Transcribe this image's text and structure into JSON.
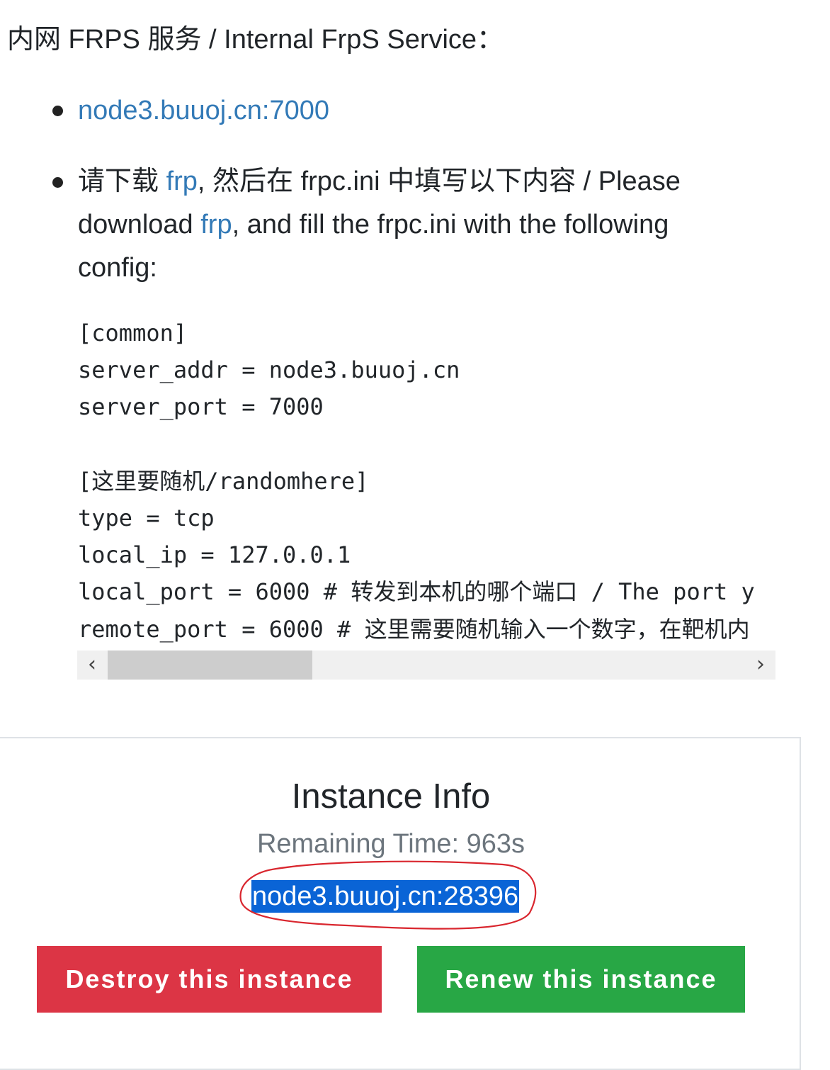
{
  "heading": "内网 FRPS 服务 / Internal FrpS Service：",
  "bullets": {
    "server_link": "node3.buuoj.cn:7000",
    "instruction_pre": "请下载 ",
    "frp_link_1": "frp",
    "instruction_mid": ", 然后在 frpc.ini 中填写以下内容 / Please download ",
    "frp_link_2": "frp",
    "instruction_post": ", and fill the frpc.ini with the following config:"
  },
  "config_code": "[common]\nserver_addr = node3.buuoj.cn\nserver_port = 7000\n\n[这里要随机/randomhere]\ntype = tcp\nlocal_ip = 127.0.0.1\nlocal_port = 6000 # 转发到本机的哪个端口 / The port y\nremote_port = 6000 # 这里需要随机输入一个数字，在靶机内",
  "scrollbar": {
    "left_arrow": "‹",
    "right_arrow": "›",
    "thumb_position": 0.0
  },
  "instance": {
    "title": "Instance Info",
    "remaining": "Remaining Time: 963s",
    "address": "node3.buuoj.cn:28396",
    "destroy_label": "Destroy this instance",
    "renew_label": "Renew this instance"
  },
  "colors": {
    "link": "#337ab7",
    "destroy": "#dc3545",
    "renew": "#28a745",
    "selection": "#0a64d6",
    "annotation": "#d9262e"
  }
}
